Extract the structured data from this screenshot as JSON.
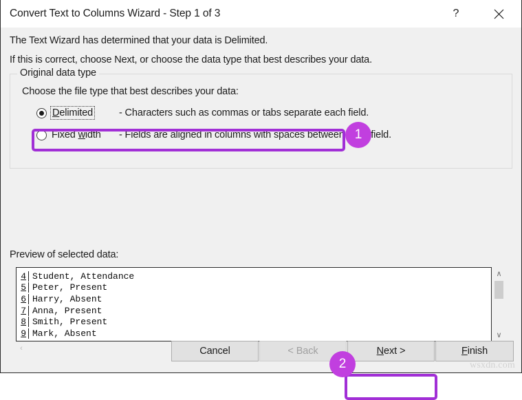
{
  "window": {
    "title": "Convert Text to Columns Wizard - Step 1 of 3",
    "help_icon": "?",
    "close_icon": "×"
  },
  "intro": {
    "line1": "The Text Wizard has determined that your data is Delimited.",
    "line2": "If this is correct, choose Next, or choose the data type that best describes your data."
  },
  "group": {
    "legend": "Original data type",
    "choose_label": "Choose the file type that best describes your data:",
    "options": [
      {
        "label_before": "",
        "label_accel": "D",
        "label_after": "elimited",
        "label_full": "Delimited",
        "description": "-  Characters such as commas or tabs separate each field.",
        "selected": true,
        "focused": true
      },
      {
        "label_before": "Fixed ",
        "label_accel": "w",
        "label_after": "idth",
        "label_full": "Fixed width",
        "description": "-  Fields are aligned in columns with spaces between each field.",
        "selected": false,
        "focused": false
      }
    ]
  },
  "preview": {
    "label": "Preview of selected data:",
    "rows": [
      {
        "number": "4",
        "text": "Student, Attendance"
      },
      {
        "number": "5",
        "text": "Peter, Present"
      },
      {
        "number": "6",
        "text": "Harry, Absent"
      },
      {
        "number": "7",
        "text": "Anna, Present"
      },
      {
        "number": "8",
        "text": "Smith, Present"
      },
      {
        "number": "9",
        "text": "Mark, Absent"
      }
    ],
    "scroll_up_icon": "∧",
    "scroll_down_icon": "∨",
    "scroll_left_icon": "‹",
    "scroll_right_icon": "›"
  },
  "footer": {
    "cancel": "Cancel",
    "back": "< Back",
    "next_before": "",
    "next_accel": "N",
    "next_after": "ext >",
    "next_full": "Next >",
    "finish_accel": "F",
    "finish_after": "inish",
    "finish_full": "Finish"
  },
  "annotations": {
    "badge1": "1",
    "badge2": "2",
    "accent_color": "#a12fd6",
    "badge_color": "#c13fdf"
  },
  "watermark": "wsxdn.com"
}
